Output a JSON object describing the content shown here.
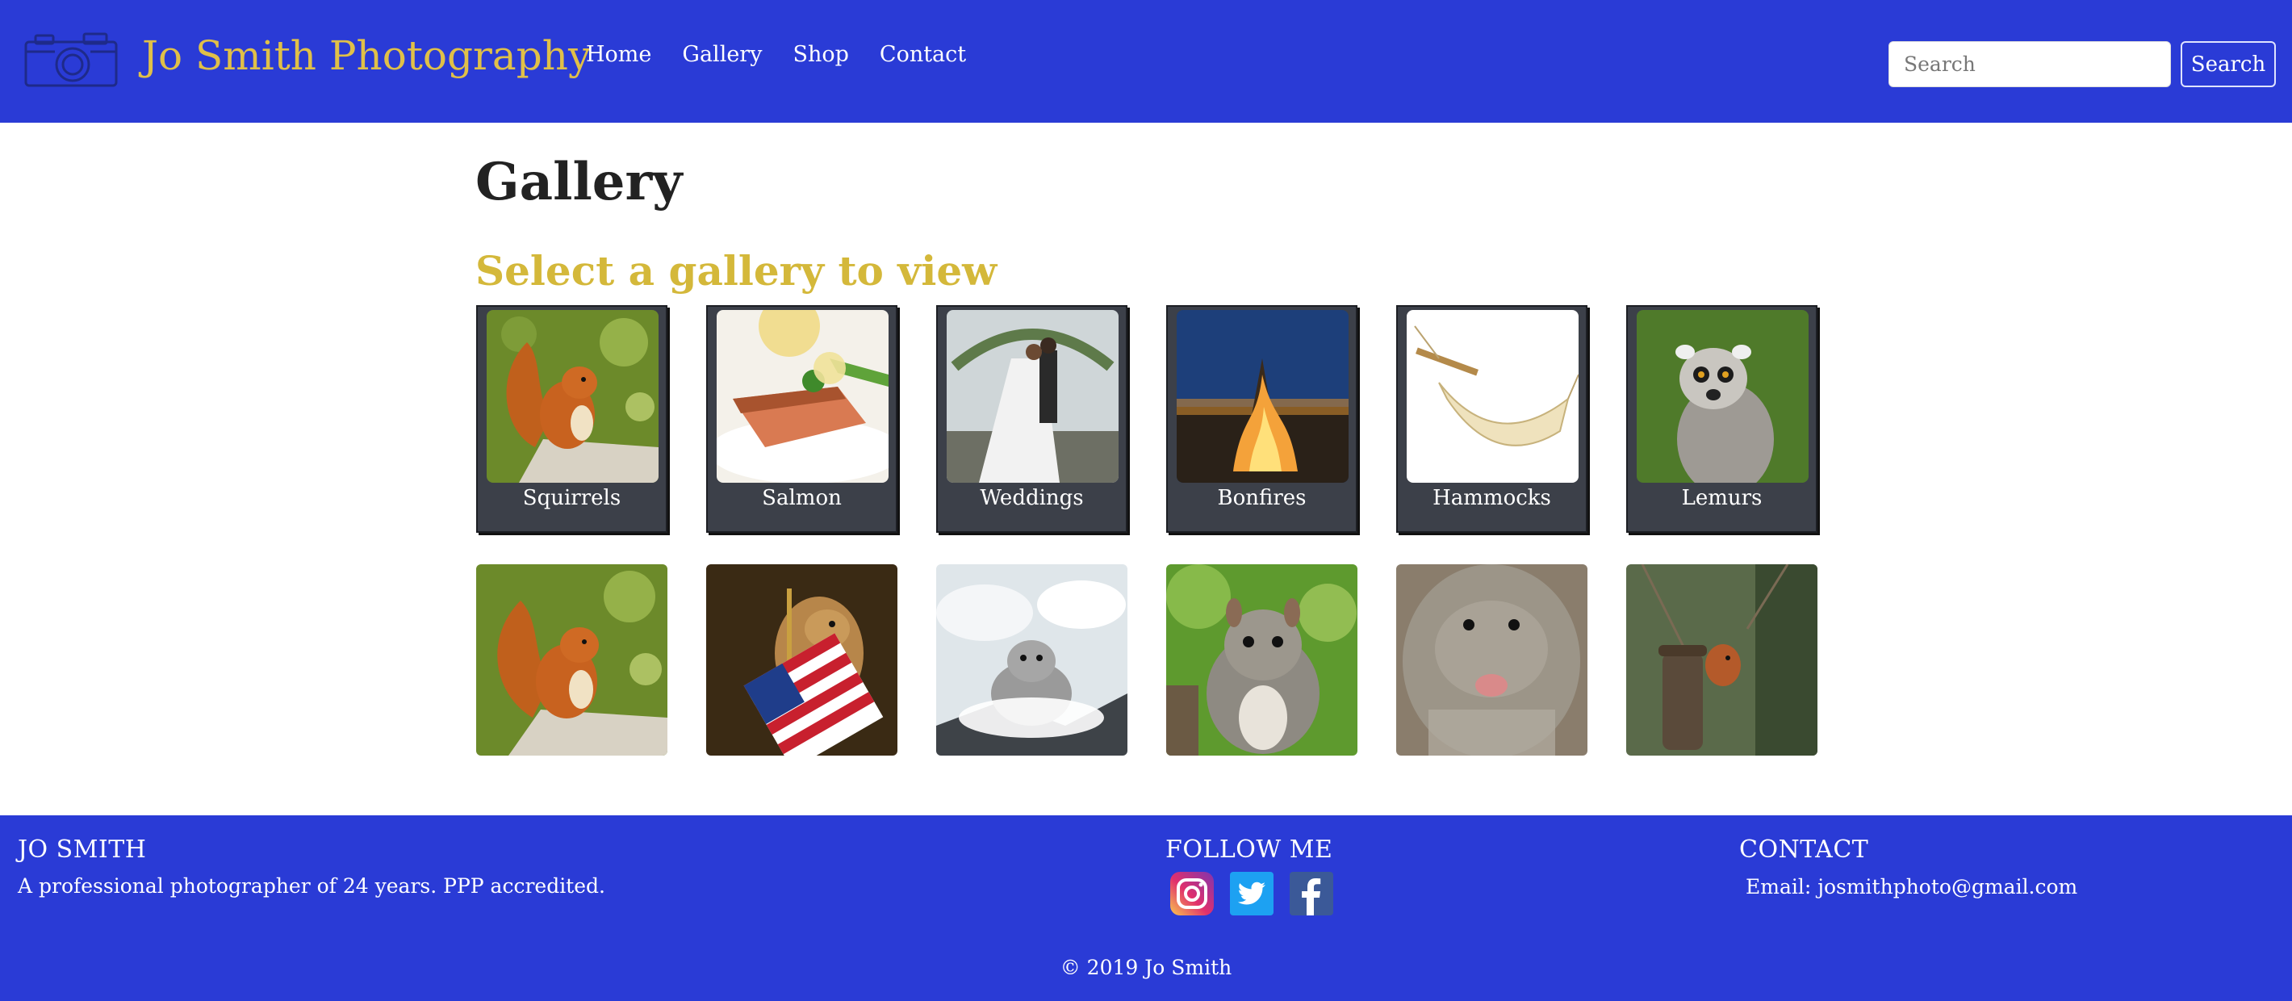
{
  "header": {
    "brand": "Jo Smith Photography",
    "nav": [
      "Home",
      "Gallery",
      "Shop",
      "Contact"
    ],
    "search_placeholder": "Search",
    "search_button": "Search"
  },
  "main": {
    "title": "Gallery",
    "subtitle": "Select a gallery to view",
    "galleries": [
      "Squirrels",
      "Salmon",
      "Weddings",
      "Bonfires",
      "Hammocks",
      "Lemurs"
    ]
  },
  "footer": {
    "about_heading": "JO SMITH",
    "about_text": "A professional photographer of 24 years. PPP accredited.",
    "follow_heading": "FOLLOW ME",
    "contact_heading": "CONTACT",
    "contact_email": "Email: josmithphoto@gmail.com",
    "copyright": "© 2019 Jo Smith"
  },
  "colors": {
    "header_bg": "#2a3bd6",
    "brand": "#e0c048",
    "subtitle": "#d4b83a",
    "card_bg": "#3c4049"
  },
  "icons": [
    "camera-logo-icon",
    "instagram-icon",
    "twitter-icon",
    "facebook-icon"
  ]
}
